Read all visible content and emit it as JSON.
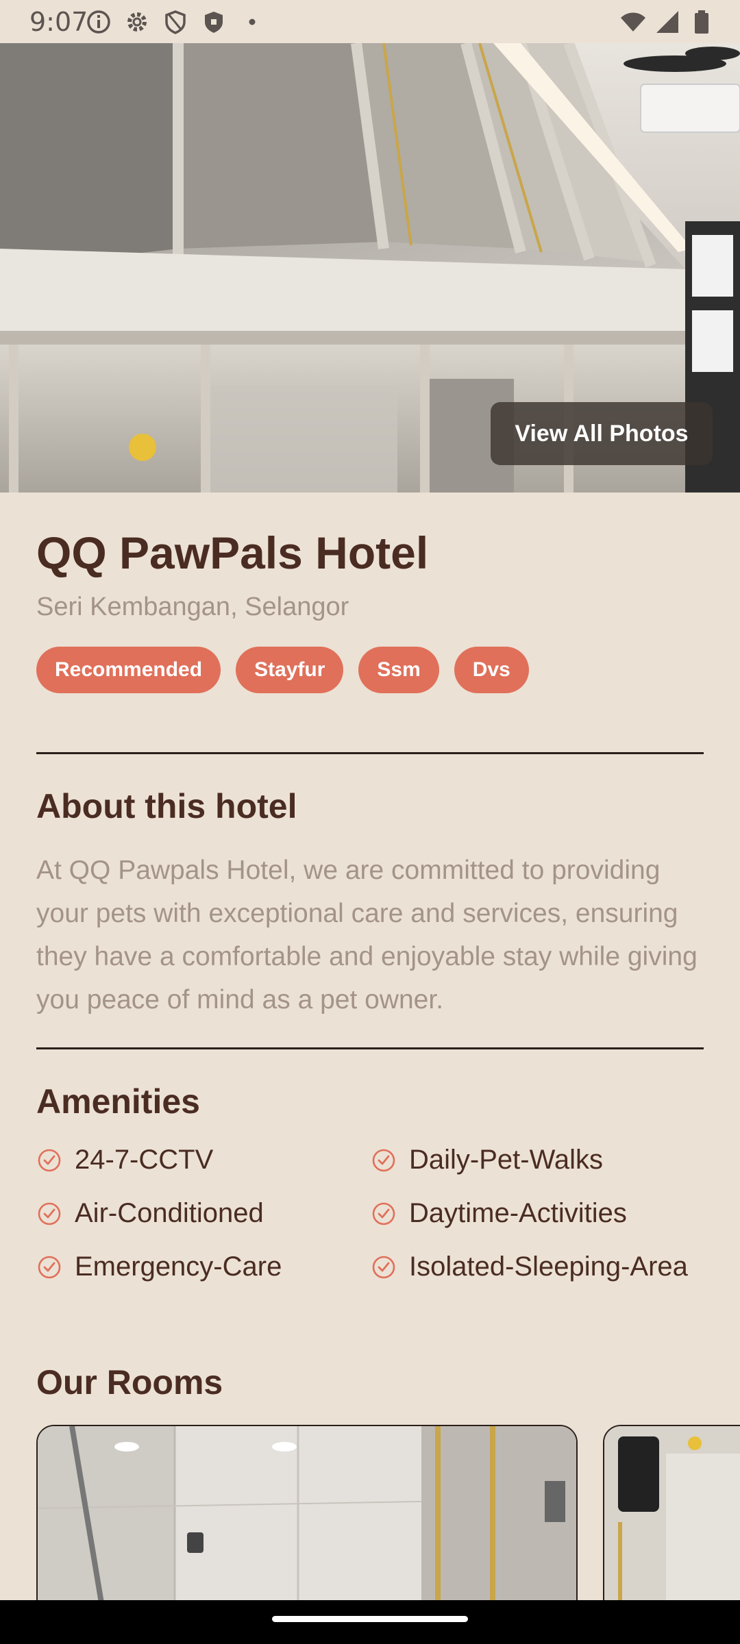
{
  "status_bar": {
    "time": "9:07",
    "left_icons": [
      "info-icon",
      "gear-icon",
      "shield-outline-icon",
      "shield-filled-icon",
      "dot-icon"
    ],
    "right_icons": [
      "wifi-icon",
      "cellular-icon",
      "battery-icon"
    ]
  },
  "hero": {
    "view_all_label": "View All Photos"
  },
  "hotel": {
    "name": "QQ PawPals Hotel",
    "location": "Seri Kembangan, Selangor",
    "tags": [
      "Recommended",
      "Stayfur",
      "Ssm",
      "Dvs"
    ]
  },
  "about": {
    "title": "About this hotel",
    "text": "At QQ Pawpals Hotel, we are committed to providing your pets with exceptional care and services, ensuring they have a comfortable and enjoyable stay while giving you peace of mind as a pet owner."
  },
  "amenities": {
    "title": "Amenities",
    "items": [
      "24-7-CCTV",
      "Daily-Pet-Walks",
      "Air-Conditioned",
      "Daytime-Activities",
      "Emergency-Care",
      "Isolated-Sleeping-Area"
    ]
  },
  "rooms": {
    "title": "Our Rooms"
  },
  "colors": {
    "background": "#ECE1D5",
    "accent": "#E0705A",
    "heading": "#4A2C22",
    "muted": "#A39388"
  }
}
